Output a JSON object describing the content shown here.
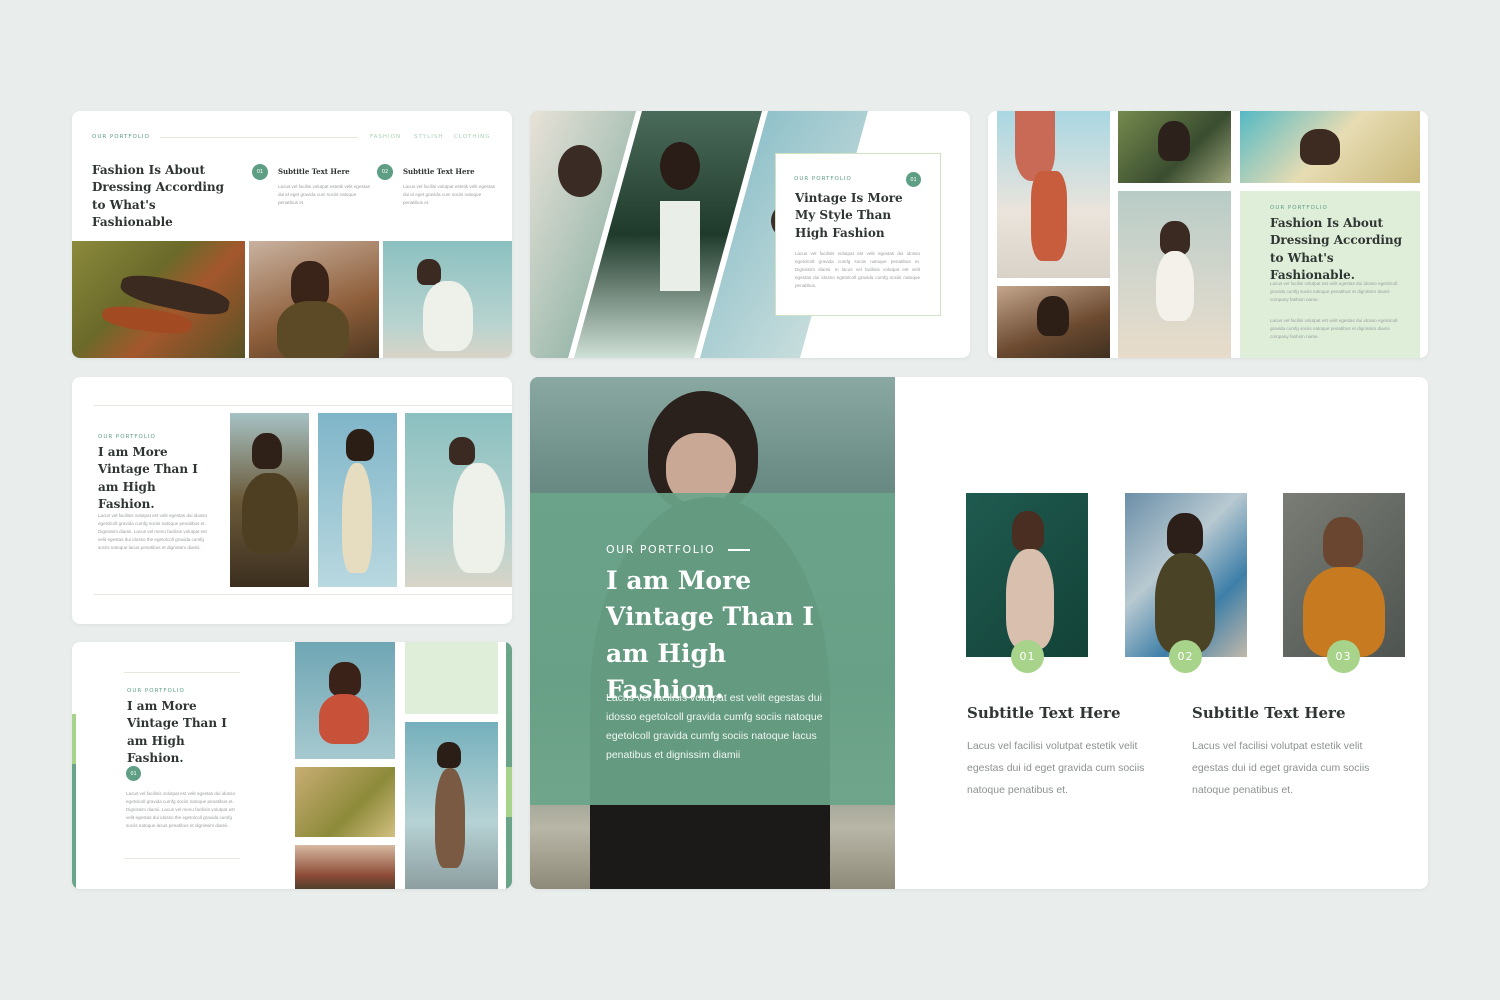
{
  "colors": {
    "accent": "#5e9e85",
    "accent_light": "#dfeed9",
    "badge_green": "#a7d38a",
    "panel": "#6aa58a"
  },
  "slide1": {
    "kicker": "OUR PORTFOLIO",
    "tags": [
      "FASHION",
      "STYLISH",
      "CLOTHING"
    ],
    "title": "Fashion Is About Dressing According to What's Fashionable",
    "items": [
      {
        "num": "01",
        "title": "Subtitle Text Here",
        "text": "Lacus vel facilisi volutpat estetik velit egestas dui id eget gravida cum sociis natoque penatibus et."
      },
      {
        "num": "02",
        "title": "Subtitle Text Here",
        "text": "Lacus vel facilisi volutpat estetik velit egestas dui id eget gravida cum sociis natoque penatibus et."
      }
    ]
  },
  "slide2": {
    "kicker": "OUR PORTFOLIO",
    "num": "01",
    "title": "Vintage Is More My Style Than High Fashion",
    "text": "Lacus vel facilisis volutpat est velit egestas dui idosso egetolcoll gravida cumfg sociis natoque penatibus et. Dignissim diamii. In lacus vel facilisis volutpat est velit egestas dui idosso egetolcoll gravida cumfg sociis natoque penatibus."
  },
  "slide3": {
    "kicker": "OUR PORTFOLIO",
    "title": "Fashion Is About Dressing According to What's Fashionable.",
    "text1": "Lacus vel facilisi volutpat est velit egestas dui idosso egetolcoll gravida cumfg sociis natoque penatibus et dignissim diamii company fashion name.",
    "text2": "Lacus vel facilisi volutpat est velit egestas dui idosso egetolcoll gravida cumfg sociis natoque penatibus et dignissim diamii company fashion name."
  },
  "slide4": {
    "kicker": "OUR PORTFOLIO",
    "title": "I am More Vintage Than I am High Fashion.",
    "text": "Lacus vel facilisis volutpat est velit egestas dui idosso egetolcoll gravida cumfg sociis natoque penatibus et. Dignissim diamii. Lacus vel menu facilisis volutpat est velit egestas dui idosso the egetolcoll gravida cumfg sociis natoque lacus penatibus et dignissim diamii."
  },
  "slide5": {
    "kicker": "OUR PORTFOLIO",
    "num": "01",
    "title": "I am More Vintage Than I am High Fashion.",
    "text": "Lacus vel facilisis volutpat est velit egestas dui idosso egetolcoll gravida cumfg sociis natoque penatibus et. Dignissim diamii. Lacus vel menu facilisis volutpat est velit egestas dui idosso the egetolcoll gravida cumfg sociis natoque lacus penatibus et dignissim diamii."
  },
  "slide6": {
    "kicker": "OUR PORTFOLIO",
    "title": "I am More Vintage Than I am High Fashion.",
    "text": "Lacus vel facilisis volutpat est velit egestas dui idosso egetolcoll gravida cumfg sociis natoque egetolcoll gravida cumfg sociis natoque lacus penatibus et dignissim diamii",
    "badges": [
      "01",
      "02",
      "03"
    ],
    "items": [
      {
        "title": "Subtitle Text Here",
        "text": "Lacus vel facilisi volutpat estetik velit egestas dui id eget gravida cum sociis natoque penatibus et."
      },
      {
        "title": "Subtitle Text Here",
        "text": "Lacus vel facilisi volutpat estetik velit egestas dui id eget gravida cum sociis natoque penatibus et."
      }
    ]
  }
}
